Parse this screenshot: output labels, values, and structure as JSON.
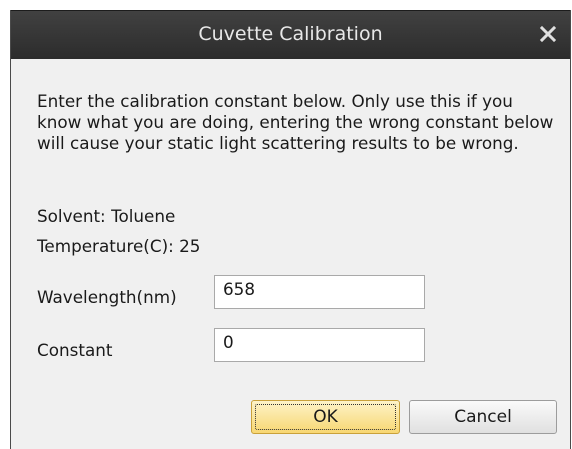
{
  "window": {
    "title": "Cuvette Calibration",
    "close_glyph": "X"
  },
  "description": "Enter the calibration constant below. Only use this if you know what you are doing, entering the wrong constant below will cause your static light scattering results to be wrong.",
  "solvent": {
    "label": "Solvent:",
    "value": "Toluene"
  },
  "temperature": {
    "label": "Temperature(C):",
    "value": "25"
  },
  "fields": {
    "wavelength": {
      "label": "Wavelength(nm)",
      "value": "658"
    },
    "constant": {
      "label": "Constant",
      "value": "0"
    }
  },
  "buttons": {
    "ok": "OK",
    "cancel": "Cancel"
  },
  "colors": {
    "titlebar": "#333333",
    "ok_button": "#f8d772"
  }
}
